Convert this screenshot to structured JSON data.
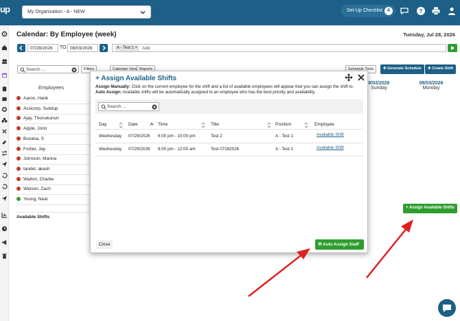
{
  "topbar": {
    "logo": "up",
    "org_select": "My Organization - A - NEW",
    "setup_label": "Set-Up Checklist",
    "setup_count": "4"
  },
  "header": {
    "title": "Calendar: By Employee (week)",
    "current_date": "Tuesday, Jul 28, 2026",
    "start_date": "07/28/2026",
    "to_label": "TO",
    "end_date": "08/03/2026",
    "filter_chip": "A - Test 1",
    "add_placeholder": "Add"
  },
  "toolbar": {
    "search_placeholder": "Search ...",
    "filters": "Filters",
    "calendar_view": "Calendar View",
    "reports": "Reports",
    "schedule_tools": "Schedule Tools",
    "generate_schedule": "Generate Schedule",
    "create_shift": "Create Shift"
  },
  "grid": {
    "employees_header": "Employees",
    "days": [
      {
        "date": "8/02/2026",
        "day": "Sunday"
      },
      {
        "date": "08/03/2026",
        "day": "Monday"
      }
    ],
    "employees": [
      {
        "name": "Aaron, Hank",
        "status": "red"
      },
      {
        "name": "Acsicorp, Subitup",
        "status": "red"
      },
      {
        "name": "Ajay, Thonukunuri",
        "status": "red"
      },
      {
        "name": "Apple, Jonn",
        "status": "red"
      },
      {
        "name": "Buvana, S",
        "status": "red"
      },
      {
        "name": "Fortier, Jay",
        "status": "red"
      },
      {
        "name": "Johnson, Marina",
        "status": "red"
      },
      {
        "name": "tandel, akash",
        "status": "red"
      },
      {
        "name": "Walton, Charlie",
        "status": "red"
      },
      {
        "name": "Watson, Zach",
        "status": "red"
      },
      {
        "name": "Young, Neal",
        "status": "green"
      }
    ],
    "available_shifts_label": "Available Shifts",
    "assign_button": "+ Assign Available Shifts"
  },
  "modal": {
    "title": "+ Assign Available Shifts",
    "manual_label": "Assign Manually:",
    "manual_text": "Click on the current employee for the shift and a list of available employees will appear that you can assign the shift to.",
    "auto_label": "Auto Assign:",
    "auto_text": "Available shifts will be automatically assigned to an employee who has the best priority and availability.",
    "search_placeholder": "Search ...",
    "columns": [
      "Day",
      "Date",
      "Time",
      "Title",
      "Position",
      "Employee"
    ],
    "rows": [
      {
        "day": "Wednesday",
        "date": "07/29/2026",
        "time": "6:00 pm - 10:00 pm",
        "title": "Test 2",
        "position": "A - Test 1",
        "employee": "Available Shift"
      },
      {
        "day": "Wednesday",
        "date": "07/29/2026",
        "time": "8:00 pm - 12:00 am",
        "title": "Test 07282026",
        "position": "A - Test 1",
        "employee": "Available Shift"
      }
    ],
    "close_label": "Close",
    "auto_assign_label": "Auto Assign Staff"
  },
  "colors": {
    "brand": "#1d5f86",
    "green": "#2e9d2e",
    "arrow": "#e02020"
  }
}
